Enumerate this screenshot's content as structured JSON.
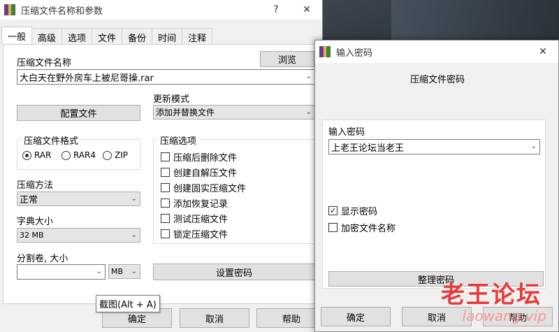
{
  "main_dialog": {
    "title": "压缩文件名称和参数",
    "help_btn": "?",
    "close_btn": "✕",
    "tabs": [
      "一般",
      "高级",
      "选项",
      "文件",
      "备份",
      "时间",
      "注释"
    ],
    "archive_name_label": "压缩文件名称",
    "browse_label": "浏览",
    "archive_name_value": "大白天在野外房车上被尼哥操.rar",
    "update_mode_label": "更新模式",
    "update_mode_value": "添加并替换文件",
    "profiles_label": "配置文件",
    "format_group_title": "压缩文件格式",
    "formats": [
      "RAR",
      "RAR4",
      "ZIP"
    ],
    "selected_format": "RAR",
    "method_label": "压缩方法",
    "method_value": "正常",
    "dict_label": "字典大小",
    "dict_value": "32 MB",
    "split_label": "分割卷, 大小",
    "split_value": "",
    "split_unit": "MB",
    "options_group_title": "压缩选项",
    "options": [
      {
        "label": "压缩后删除文件",
        "checked": false
      },
      {
        "label": "创建自解压文件",
        "checked": false
      },
      {
        "label": "创建固实压缩文件",
        "checked": false
      },
      {
        "label": "添加恢复记录",
        "checked": false
      },
      {
        "label": "测试压缩文件",
        "checked": false
      },
      {
        "label": "锁定压缩文件",
        "checked": false
      }
    ],
    "set_password_label": "设置密码",
    "tooltip": "截图(Alt + A)",
    "ok_label": "确定",
    "cancel_label": "取消",
    "help_label": "帮助"
  },
  "password_dialog": {
    "title": "输入密码",
    "close_btn": "✕",
    "heading": "压缩文件密码",
    "enter_label": "输入密码",
    "password_value": "上老王论坛当老王",
    "show_password_label": "显示密码",
    "show_password_checked": true,
    "encrypt_names_label": "加密文件名称",
    "encrypt_names_checked": false,
    "organize_label": "整理密码",
    "ok_label": "确定",
    "cancel_label": "取消",
    "help_label": "帮助"
  },
  "watermark": {
    "text": "老王论坛",
    "url_text": "laowang.vip"
  }
}
